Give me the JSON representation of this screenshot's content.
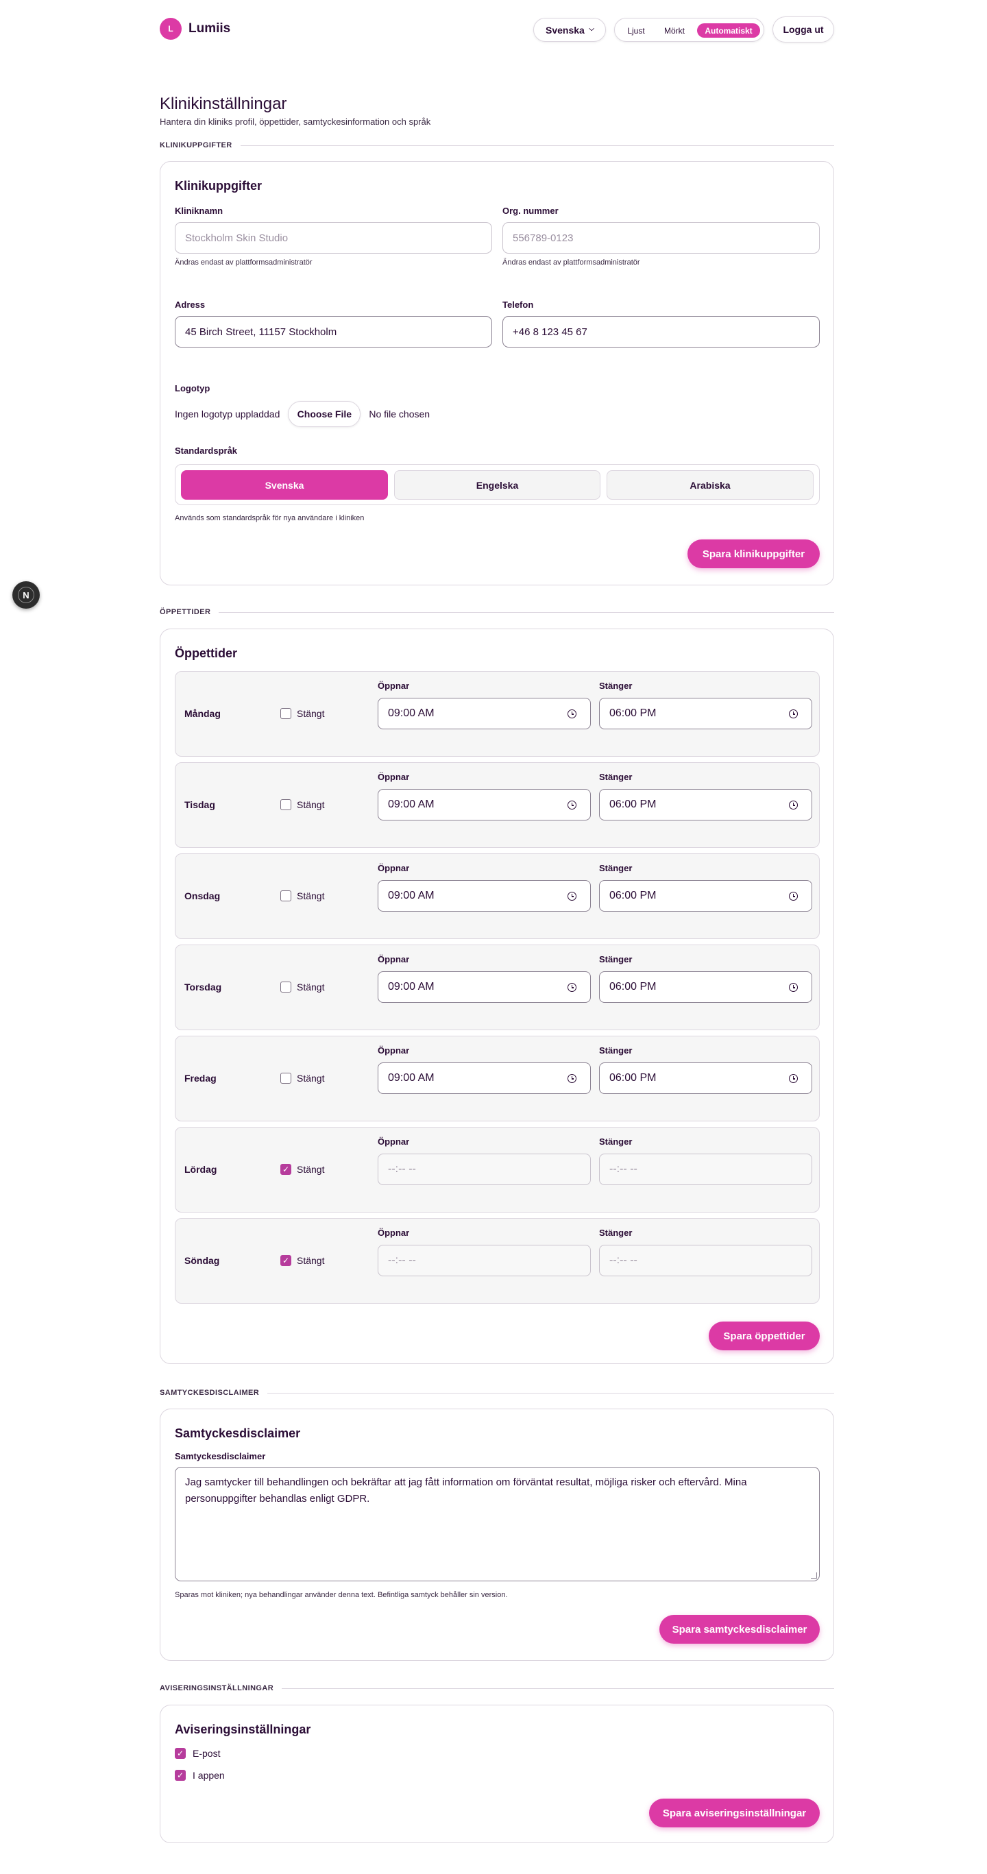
{
  "header": {
    "brand_initial": "L",
    "brand_name": "Lumiis",
    "language": "Svenska",
    "theme_options": [
      "Ljust",
      "Mörkt",
      "Automatiskt"
    ],
    "theme_selected": "Automatiskt",
    "logout_label": "Logga ut"
  },
  "page": {
    "title": "Klinikinställningar",
    "subtitle": "Hantera din kliniks profil, öppettider, samtyckesinformation och språk"
  },
  "clinic": {
    "section_label": "KLINIKUPPGIFTER",
    "card_title": "Klinikuppgifter",
    "name_label": "Kliniknamn",
    "name_value": "Stockholm Skin Studio",
    "name_hint": "Ändras endast av plattformsadministratör",
    "org_label": "Org. nummer",
    "org_value": "556789-0123",
    "org_hint": "Ändras endast av plattformsadministratör",
    "address_label": "Adress",
    "address_value": "45 Birch Street, 11157 Stockholm",
    "phone_label": "Telefon",
    "phone_value": "+46 8 123 45 67",
    "logo_label": "Logotyp",
    "logo_status": "Ingen logotyp uppladdad",
    "choose_file": "Choose File",
    "no_file": "No file chosen",
    "default_lang_label": "Standardspråk",
    "languages": [
      "Svenska",
      "Engelska",
      "Arabiska"
    ],
    "selected_language": "Svenska",
    "lang_hint": "Används som standardspråk för nya användare i kliniken",
    "save_label": "Spara klinikuppgifter"
  },
  "hours": {
    "section_label": "ÖPPETTIDER",
    "card_title": "Öppettider",
    "open_label": "Öppnar",
    "close_label": "Stänger",
    "closed_label": "Stängt",
    "days": [
      {
        "name": "Måndag",
        "closed": false,
        "open": "09:00 AM",
        "close": "06:00 PM"
      },
      {
        "name": "Tisdag",
        "closed": false,
        "open": "09:00 AM",
        "close": "06:00 PM"
      },
      {
        "name": "Onsdag",
        "closed": false,
        "open": "09:00 AM",
        "close": "06:00 PM"
      },
      {
        "name": "Torsdag",
        "closed": false,
        "open": "09:00 AM",
        "close": "06:00 PM"
      },
      {
        "name": "Fredag",
        "closed": false,
        "open": "09:00 AM",
        "close": "06:00 PM"
      },
      {
        "name": "Lördag",
        "closed": true,
        "open": "--:-- --",
        "close": "--:-- --"
      },
      {
        "name": "Söndag",
        "closed": true,
        "open": "--:-- --",
        "close": "--:-- --"
      }
    ],
    "save_label": "Spara öppettider"
  },
  "consent": {
    "section_label": "SAMTYCKESDISCLAIMER",
    "card_title": "Samtyckesdisclaimer",
    "field_label": "Samtyckesdisclaimer",
    "text": "Jag samtycker till behandlingen och bekräftar att jag fått information om förväntat resultat, möjliga risker och eftervård. Mina personuppgifter behandlas enligt GDPR.",
    "hint": "Sparas mot kliniken; nya behandlingar använder denna text. Befintliga samtyck behåller sin version.",
    "save_label": "Spara samtyckesdisclaimer"
  },
  "notifications": {
    "section_label": "AVISERINGSINSTÄLLNINGAR",
    "card_title": "Aviseringsinställningar",
    "email_label": "E-post",
    "email_checked": true,
    "app_label": "I appen",
    "app_checked": true,
    "save_label": "Spara aviseringsinställningar"
  },
  "devtools": {
    "badge": "N"
  },
  "colors": {
    "accent": "#dc3aa5",
    "text": "#2b0d36",
    "border": "#dcd6df"
  }
}
